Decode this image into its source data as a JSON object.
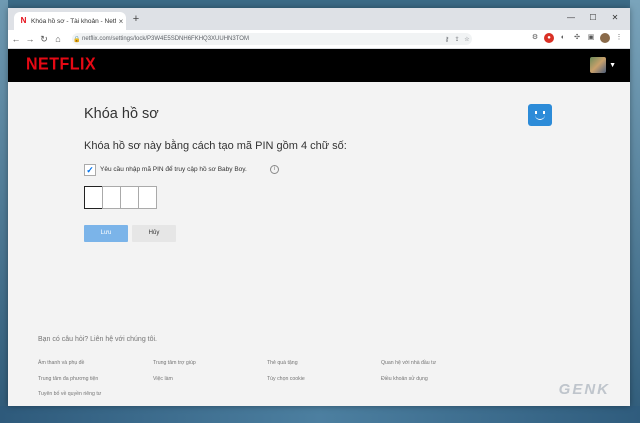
{
  "browser": {
    "tab_title": "Khóa hồ sơ - Tài khoản - Netflix",
    "tab_close": "×",
    "new_tab": "+",
    "url": "netflix.com/settings/lock/P3W4E5SDNH6FKHQ3XUUHN3TOM",
    "window_controls": [
      "—",
      "☐",
      "✕"
    ]
  },
  "netflix": {
    "logo": "NETFLIX",
    "brand_color": "#e50914",
    "caret": "▼"
  },
  "page": {
    "title": "Khóa hồ sơ",
    "subtitle": "Khóa hồ sơ này bằng cách tạo mã PIN gồm 4 chữ số:",
    "checkbox_label": "Yêu cầu nhập mã PIN để truy cập hồ sơ Baby Boy.",
    "checkbox_checked": true,
    "info_icon": "i",
    "save_label": "Lưu",
    "cancel_label": "Hủy"
  },
  "footer": {
    "question": "Bạn có câu hỏi? Liên hệ với chúng tôi.",
    "links": [
      "Âm thanh và phụ đề",
      "Trung tâm trợ giúp",
      "Thẻ quà tặng",
      "Quan hệ với nhà đầu tư",
      "Trung tâm đa phương tiện",
      "Việc làm",
      "Tùy chọn cookie",
      "Điều khoản sử dụng",
      "Tuyên bố về quyền riêng tư"
    ]
  },
  "watermark": "GENK"
}
